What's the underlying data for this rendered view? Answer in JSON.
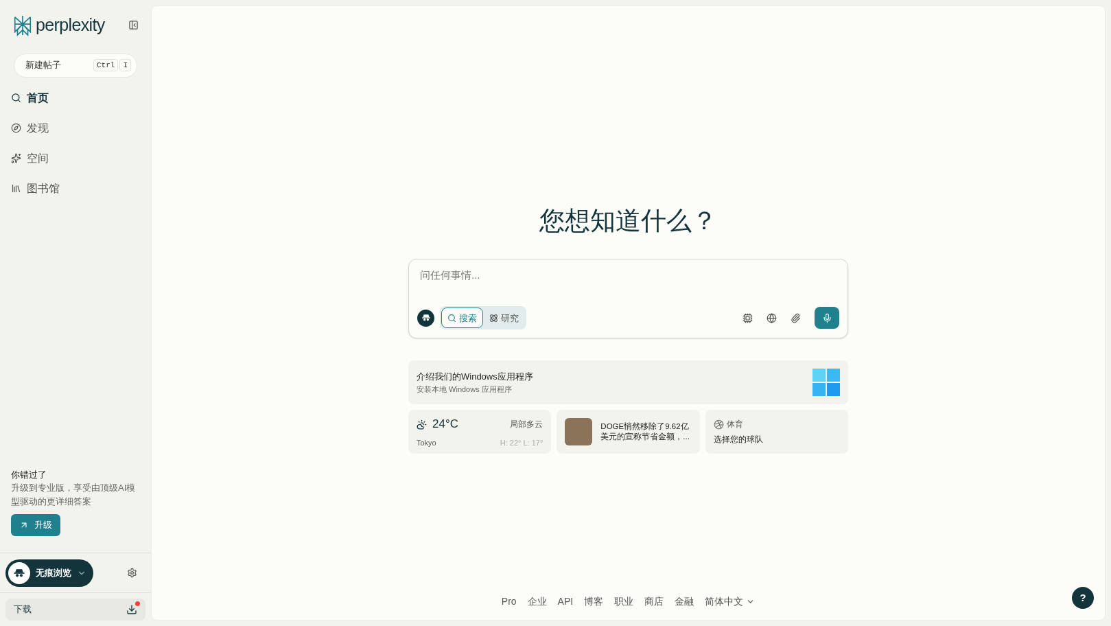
{
  "sidebar": {
    "brand": "perplexity",
    "new_thread": {
      "label": "新建帖子",
      "keys": [
        "Ctrl",
        "I"
      ]
    },
    "nav": [
      {
        "label": "首页",
        "selected": true
      },
      {
        "label": "发现",
        "selected": false
      },
      {
        "label": "空间",
        "selected": false
      },
      {
        "label": "图书馆",
        "selected": false
      }
    ],
    "promo": {
      "title": "你错过了",
      "text": "升级到专业版，享受由顶级AI模型驱动的更详细答案",
      "button": "升级"
    },
    "incognito": {
      "label": "无痕浏览"
    },
    "download": {
      "label": "下载",
      "notification": true
    }
  },
  "main": {
    "heading": "您想知道什么？",
    "query": {
      "placeholder": "问任何事情...",
      "modes": [
        {
          "label": "搜索",
          "selected": true
        },
        {
          "label": "研究",
          "selected": false
        }
      ]
    },
    "windows_card": {
      "title": "介绍我们的Windows应用程序",
      "subtitle": "安装本地 Windows 应用程序"
    },
    "weather": {
      "temp": "24°C",
      "condition": "局部多云",
      "city": "Tokyo",
      "range": "H: 22° L: 17°"
    },
    "news": {
      "text": "DOGE悄然移除了9.62亿美元的宣称节省金额，..."
    },
    "sports": {
      "title": "体育",
      "text": "选择您的球队"
    },
    "footer": {
      "links": [
        "Pro",
        "企业",
        "API",
        "博客",
        "职业",
        "商店",
        "金融"
      ],
      "language": "简体中文"
    },
    "help": "?"
  }
}
